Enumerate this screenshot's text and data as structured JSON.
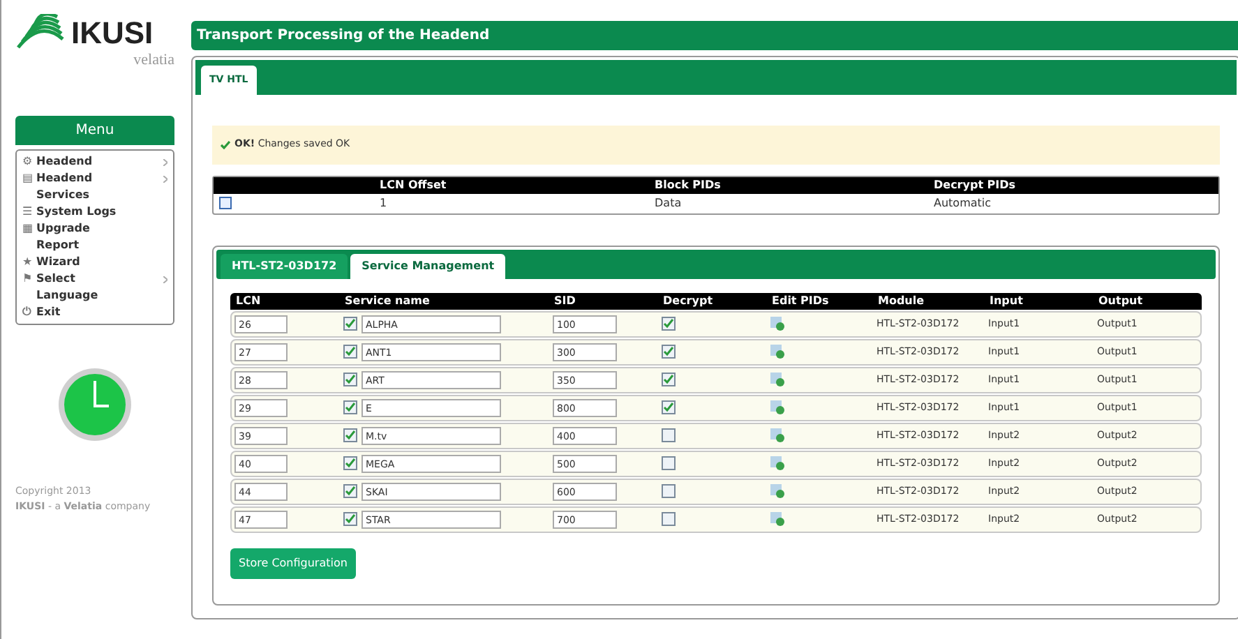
{
  "logo": {
    "brand": "IKUSI",
    "sub": "velatia"
  },
  "menu": {
    "title": "Menu",
    "items": [
      {
        "label": "Headend",
        "icon": "⚙",
        "submenu": true
      },
      {
        "label": "Headend Services",
        "icon": "▤",
        "submenu": true
      },
      {
        "label": "System Logs",
        "icon": "☰",
        "submenu": false
      },
      {
        "label": "Upgrade Report",
        "icon": "▦",
        "submenu": false
      },
      {
        "label": "Wizard",
        "icon": "★",
        "submenu": false
      },
      {
        "label": "Select Language",
        "icon": "⚑",
        "submenu": true
      },
      {
        "label": "Exit",
        "icon": "⏻",
        "submenu": false
      }
    ]
  },
  "copyright": {
    "line1": "Copyright 2013",
    "line2": "**IKUSI** - a **Velatia** company"
  },
  "page_title": "Transport Processing of the Headend",
  "tabs": [
    {
      "label": "TV HTL",
      "selected": true
    }
  ],
  "alert": {
    "strong": "OK!",
    "text": "Changes saved OK"
  },
  "offset_table": {
    "columns": [
      "LCN Offset",
      "Block PIDs",
      "Decrypt PIDs"
    ],
    "row": [
      "1",
      "Data",
      "Automatic"
    ]
  },
  "sub_tabs": [
    {
      "label": "HTL-ST2-03D172",
      "selected": false
    },
    {
      "label": "Service Management",
      "selected": true
    }
  ],
  "services": {
    "columns": [
      "LCN",
      "Service name",
      "SID",
      "Decrypt",
      "Edit PIDs",
      "Module",
      "Input",
      "Output"
    ],
    "rows": [
      {
        "lcn": "26",
        "enabled": true,
        "name": "ALPHA",
        "sid": "100",
        "decrypt": true,
        "module": "HTL-ST2-03D172",
        "input": "Input1",
        "output": "Output1"
      },
      {
        "lcn": "27",
        "enabled": true,
        "name": "ANT1",
        "sid": "300",
        "decrypt": true,
        "module": "HTL-ST2-03D172",
        "input": "Input1",
        "output": "Output1"
      },
      {
        "lcn": "28",
        "enabled": true,
        "name": "ART",
        "sid": "350",
        "decrypt": true,
        "module": "HTL-ST2-03D172",
        "input": "Input1",
        "output": "Output1"
      },
      {
        "lcn": "29",
        "enabled": true,
        "name": "E",
        "sid": "800",
        "decrypt": true,
        "module": "HTL-ST2-03D172",
        "input": "Input1",
        "output": "Output1"
      },
      {
        "lcn": "39",
        "enabled": true,
        "name": "M.tv",
        "sid": "400",
        "decrypt": false,
        "module": "HTL-ST2-03D172",
        "input": "Input2",
        "output": "Output2"
      },
      {
        "lcn": "40",
        "enabled": true,
        "name": "MEGA",
        "sid": "500",
        "decrypt": false,
        "module": "HTL-ST2-03D172",
        "input": "Input2",
        "output": "Output2"
      },
      {
        "lcn": "44",
        "enabled": true,
        "name": "SKAI",
        "sid": "600",
        "decrypt": false,
        "module": "HTL-ST2-03D172",
        "input": "Input2",
        "output": "Output2"
      },
      {
        "lcn": "47",
        "enabled": true,
        "name": "STAR",
        "sid": "700",
        "decrypt": false,
        "module": "HTL-ST2-03D172",
        "input": "Input2",
        "output": "Output2"
      }
    ]
  },
  "store_button": "Store Configuration"
}
